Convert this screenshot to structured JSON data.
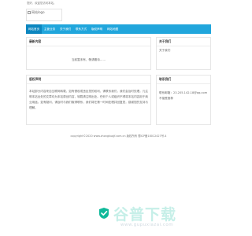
{
  "topbar": {
    "text": "您好，欢迎您访问本站。"
  },
  "logo": {
    "alt_text": "网站logo"
  },
  "nav": {
    "items": [
      {
        "label": "网站首页",
        "active": true
      },
      {
        "label": "主营业务",
        "active": false
      },
      {
        "label": "关于我们",
        "active": false
      },
      {
        "label": "联系方式",
        "active": false
      },
      {
        "label": "版权声明",
        "active": false
      },
      {
        "label": "网站地图",
        "active": false
      }
    ]
  },
  "main_left": {
    "title": "最新内容",
    "empty_text": "当前暂未有，敬请期待……"
  },
  "main_right": {
    "title": "关于我们",
    "text": "关于我们"
  },
  "copyright_panel": {
    "title": "版权声明",
    "text": "本站部分内容来自互联网转载，如有侵权或违反您的权利，请联系我们，我们会及时处理。凡注明本站出处的文章均为本站原创内容，转载请注明出处。任何个人或组织不得将本站内容用于商业用途。如有疑问，请及时与我们取得联系，我们将在第一时间处理并回复您，感谢您的支持与理解。"
  },
  "contact_panel": {
    "title": "联系我们",
    "lines": [
      "联系邮箱：23.205.142.18@qq.com",
      "不接受推荐"
    ]
  },
  "footer": {
    "text": "copyright©2020 www.zhongkuqjf.com.cn 版权所有  蜀ICP备18012427号-4"
  },
  "watermark": {
    "cn": "谷普下载",
    "en": "www.gupuxiazai.com",
    "colors": {
      "text": "#c6efe8",
      "fill": "#10b99a"
    }
  },
  "colors": {
    "nav": "#21a6dc",
    "nav_active": "#0c86bf"
  }
}
